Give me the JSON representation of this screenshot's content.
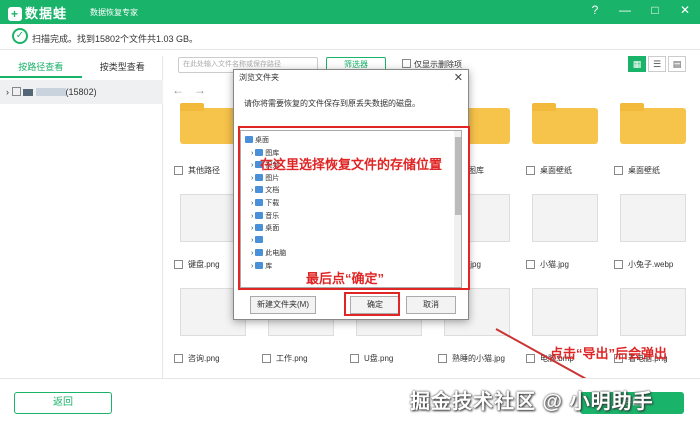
{
  "app": {
    "name": "数据蛙",
    "subtitle": "数据恢复专家",
    "status": "扫描完成。找到15802个文件共1.03 GB。"
  },
  "window_buttons": [
    "?",
    "—",
    "□",
    "✕"
  ],
  "tabs": [
    "按路径查看",
    "按类型查看"
  ],
  "tree": {
    "item": "(15802)"
  },
  "toolbar": {
    "search_placeholder": "在此处输入文件名称或保存路径",
    "filter_label": "筛选器",
    "only_deleted_label": "仅显示删除项"
  },
  "grid_items": [
    {
      "name": "其他路径",
      "type": "folder"
    },
    {
      "name": "",
      "type": "folder"
    },
    {
      "name": "",
      "type": "folder"
    },
    {
      "name": "桌面图库",
      "type": "folder"
    },
    {
      "name": "桌面壁纸",
      "type": "folder"
    },
    {
      "name": "桌面壁纸",
      "type": "folder"
    },
    {
      "name": "键盘.png",
      "type": "image"
    },
    {
      "name": "",
      "type": "image"
    },
    {
      "name": "",
      "type": "image"
    },
    {
      "name": "美女.jpg",
      "type": "image"
    },
    {
      "name": "小猫.jpg",
      "type": "image"
    },
    {
      "name": "小兔子.webp",
      "type": "image"
    },
    {
      "name": "咨询.png",
      "type": "image"
    },
    {
      "name": "工作.png",
      "type": "image"
    },
    {
      "name": "U盘.png",
      "type": "image"
    },
    {
      "name": "熟睡的小猫.jpg",
      "type": "image"
    },
    {
      "name": "电脑.bmp",
      "type": "image"
    },
    {
      "name": "看电脑.png",
      "type": "image"
    }
  ],
  "dialog": {
    "title": "浏览文件夹",
    "description": "请你将需要恢复的文件保存到原丢失数据的磁盘。",
    "tree_items": [
      "桌面",
      "图库",
      "视频",
      "图片",
      "文档",
      "下载",
      "音乐",
      "桌面",
      "",
      "此电脑",
      "库"
    ],
    "new_folder_label": "新建文件夹(M)",
    "ok_label": "确定",
    "cancel_label": "取消"
  },
  "annotations": {
    "choose_location": "在这里选择恢复文件的存储位置",
    "click_ok": "最后点“确定”",
    "export_popup": "点击“导出”后会弹出"
  },
  "bottom": {
    "back_label": "返回",
    "export_label": "导出"
  },
  "watermark": "掘金技术社区 @ 小明助手",
  "colors": {
    "brand": "#1ab36a",
    "annotation": "#e02525",
    "folder": "#f6c34b"
  }
}
